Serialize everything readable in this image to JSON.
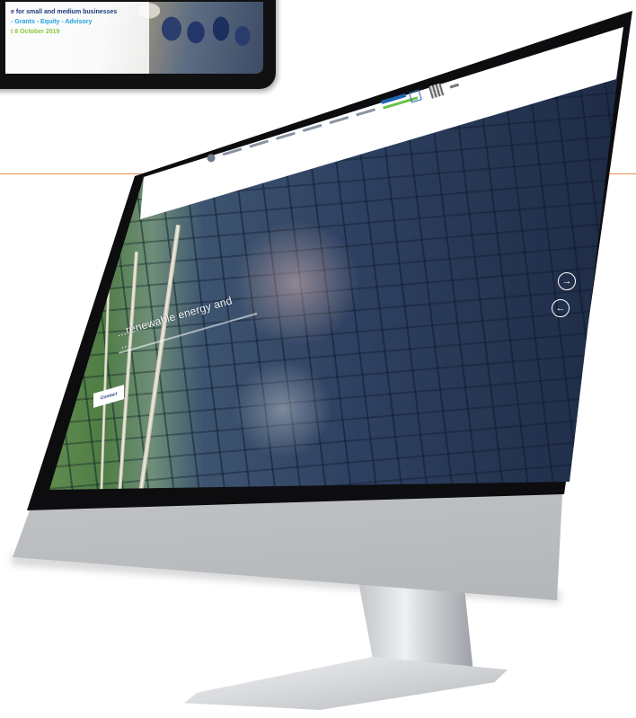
{
  "tablet": {
    "line1": "e for small and medium businesses",
    "line2": "- Grants - Equity - Advisory",
    "line3": "t 8 October 2019"
  },
  "website": {
    "hero_text": "...renewable energy and",
    "hero_text2": "...",
    "hero_button": "Contact",
    "next_arrow": "→",
    "prev_arrow": "←"
  },
  "colors": {
    "accent_orange": "#f08c4a",
    "brand_blue": "#1d3b7a",
    "brand_cyan": "#22a3d8",
    "brand_green": "#8dc63f",
    "bezel": "#0d0d0f"
  }
}
